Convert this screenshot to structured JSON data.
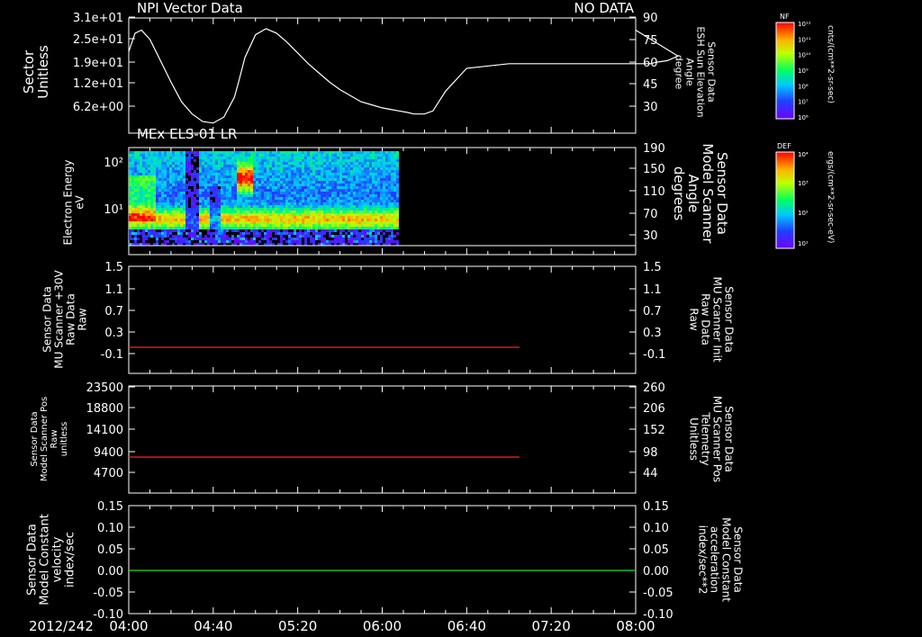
{
  "colors": {
    "background": "#000000",
    "foreground": "#ffffff",
    "trace_red": "#ff2020",
    "trace_green": "#20e020",
    "label_red": "#ff2020",
    "label_green": "#20e020"
  },
  "chart_data": [
    {
      "type": "line",
      "panel": "panel1",
      "title": "NPI Vector Data",
      "status": "NO DATA",
      "ylabel_left": [
        "Sector",
        "Unitless"
      ],
      "yticks_left": [
        "3.1e+01",
        "2.5e+01",
        "1.9e+01",
        "1.2e+01",
        "6.2e+00"
      ],
      "ylabel_right": [
        "Sensor Data",
        "ESH Sun Elevation",
        "Angle",
        "degree"
      ],
      "yticks_right": [
        "90",
        "75",
        "60",
        "45",
        "30"
      ],
      "ylim_right": [
        15,
        90
      ],
      "series": [
        {
          "color": "#ffffff",
          "x": [
            240,
            243,
            246,
            250,
            255,
            260,
            265,
            270,
            275,
            280,
            285,
            290,
            292,
            295,
            300,
            305,
            310,
            315,
            320,
            325,
            330,
            335,
            340,
            345,
            350,
            355,
            360,
            364,
            368,
            372,
            375,
            380,
            384,
            390,
            400,
            420,
            440,
            450,
            460,
            480,
            487,
            490,
            495,
            500,
            480
          ],
          "y": [
            68,
            80,
            82,
            76,
            62,
            48,
            35,
            27,
            22,
            21,
            25,
            38,
            48,
            64,
            79,
            83,
            80,
            74,
            67,
            60,
            54,
            48,
            43,
            39,
            35,
            33,
            31,
            30,
            29,
            28,
            27,
            27,
            29,
            42,
            57,
            60,
            60,
            60,
            60,
            60,
            60,
            61,
            62,
            65,
            60
          ]
        }
      ]
    },
    {
      "type": "heatmap",
      "panel": "panel2",
      "title": "MEx ELS-01 LR",
      "ylabel_left": [
        "Electron Energy",
        "eV"
      ],
      "yticks_left": [
        "10²",
        "10¹"
      ],
      "ylabel_right": [
        "Sensor Data",
        "Model Scanner",
        "Angle",
        "degrees"
      ],
      "yticks_right": [
        "190",
        "150",
        "110",
        "70",
        "30"
      ],
      "xlim": [
        240,
        480
      ],
      "data_x_range": [
        240,
        367
      ],
      "ylim_log_eV": [
        1.5,
        180
      ],
      "colorbar": {
        "label": "DEF",
        "units": "ergs/(cm**2-sr-sec-eV)",
        "ticks": [
          "10⁴",
          "10³",
          "10²",
          "10¹"
        ]
      }
    },
    {
      "type": "line",
      "panel": "panel3",
      "ylabel_left": [
        "Sensor Data",
        "MU Scanner +30V",
        "Raw Data",
        "Raw"
      ],
      "yticks_left": [
        "1.5",
        "1.1",
        "0.7",
        "0.3",
        "-0.1"
      ],
      "ylabel_right": [
        "Sensor Data",
        "MU Scanner Init",
        "Raw Data",
        "Raw"
      ],
      "yticks_right": [
        "1.5",
        "1.1",
        "0.7",
        "0.3",
        "-0.1"
      ],
      "ylim": [
        -0.3,
        1.5
      ],
      "series": [
        {
          "color": "#ff2020",
          "x": [
            240,
            425
          ],
          "y": [
            0.0,
            0.0
          ]
        }
      ]
    },
    {
      "type": "line",
      "panel": "panel4",
      "ylabel_left": [
        "Sensor Data",
        "Model Scanner Pos",
        "Raw",
        "unitless"
      ],
      "yticks_left": [
        "23500",
        "18800",
        "14100",
        "9400",
        "4700"
      ],
      "ylabel_right": [
        "Sensor Data",
        "MU Scanner Pos",
        "Telemetry",
        "Unitless"
      ],
      "yticks_right": [
        "260",
        "206",
        "152",
        "98",
        "44"
      ],
      "ylim": [
        0,
        23500
      ],
      "series": [
        {
          "color": "#ff2020",
          "x": [
            240,
            425
          ],
          "y": [
            8000,
            8000
          ]
        }
      ]
    },
    {
      "type": "line",
      "panel": "panel5",
      "ylabel_left": [
        "Sensor Data",
        "Model Constant",
        "velocity",
        "index/sec"
      ],
      "yticks_left": [
        "0.15",
        "0.10",
        "0.05",
        "0.00",
        "-0.05",
        "-0.10"
      ],
      "ylabel_right": [
        "Sensor Data",
        "Model Constant",
        "acceleration",
        "index/sec**2"
      ],
      "yticks_right": [
        "0.15",
        "0.10",
        "0.05",
        "0.00",
        "-0.05",
        "-0.10"
      ],
      "ylim": [
        -0.1,
        0.15
      ],
      "series": [
        {
          "color": "#20e020",
          "x": [
            240,
            480
          ],
          "y": [
            0.0,
            0.0
          ]
        }
      ]
    }
  ],
  "x_axis": {
    "date": "2012/242",
    "tick_labels": [
      "04:00",
      "04:40",
      "05:20",
      "06:00",
      "06:40",
      "07:20",
      "08:00"
    ],
    "tick_values_min": [
      240,
      280,
      320,
      360,
      400,
      440,
      480
    ],
    "xlim_min": [
      240,
      480
    ]
  },
  "colorbar_top": {
    "label": "NF",
    "units": "cnts/(cm**2-sr-sec)",
    "ticks": [
      "10¹²",
      "10¹¹",
      "10¹⁰",
      "10⁹",
      "10⁸",
      "10⁷",
      "10⁶"
    ]
  }
}
